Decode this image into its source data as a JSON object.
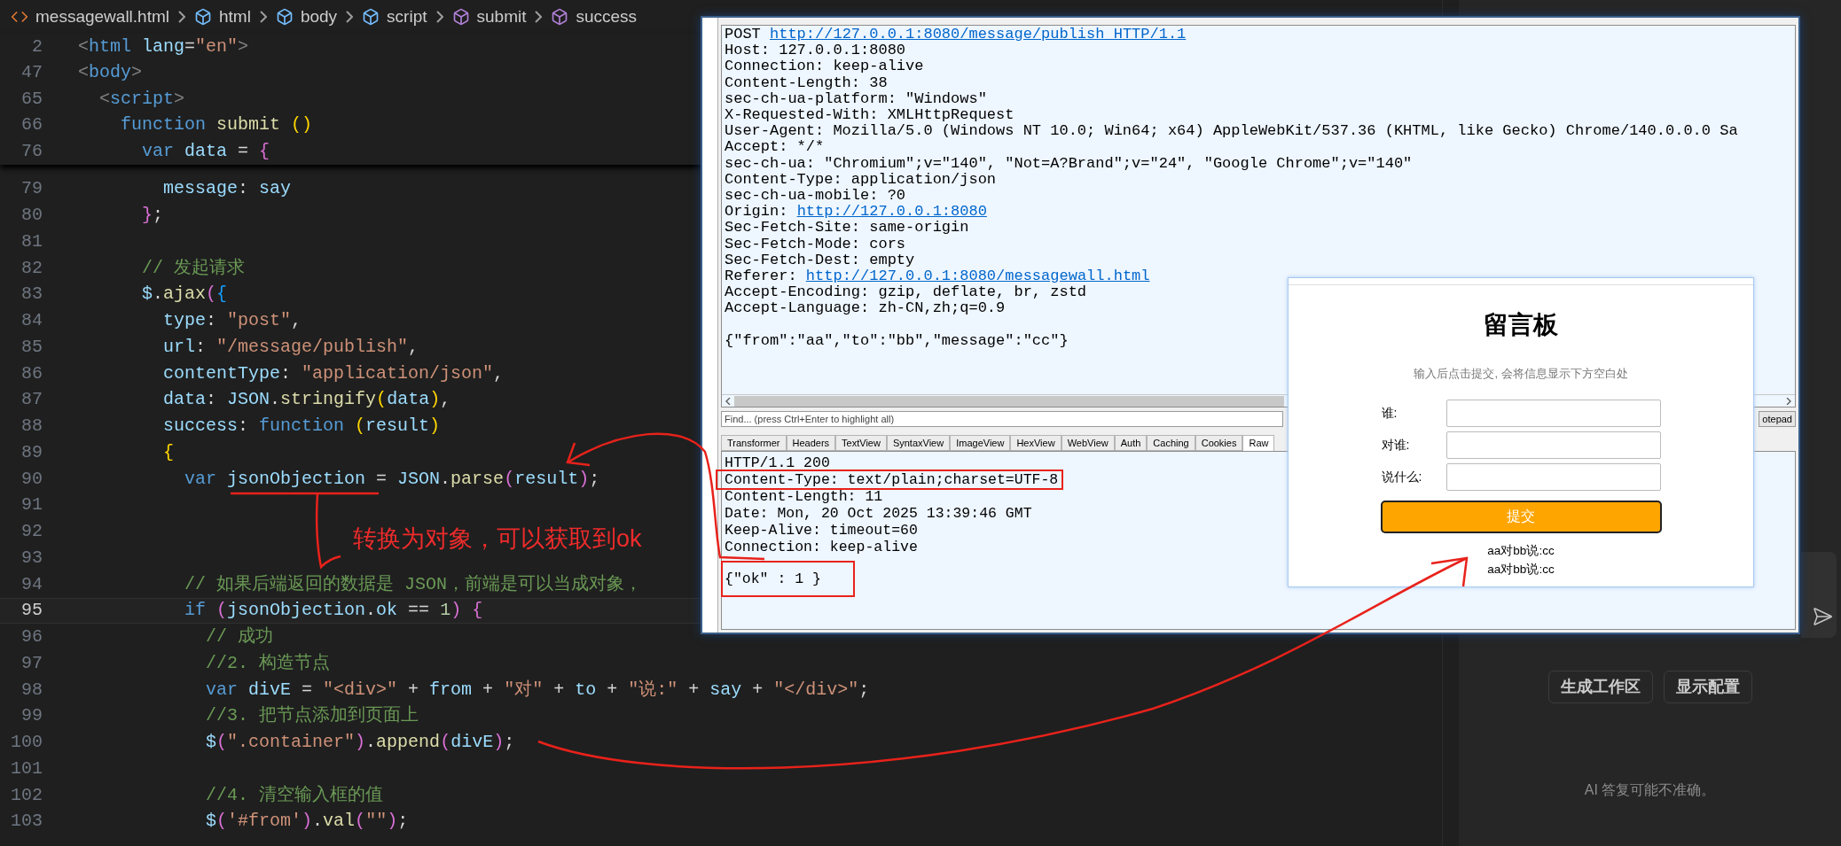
{
  "editor": {
    "breadcrumbs": [
      {
        "label": "messagewall.html",
        "kind": "file"
      },
      {
        "label": "html",
        "kind": "element"
      },
      {
        "label": "body",
        "kind": "element"
      },
      {
        "label": "script",
        "kind": "element"
      },
      {
        "label": "submit",
        "kind": "function"
      },
      {
        "label": "success",
        "kind": "function"
      }
    ],
    "sticky_lines": [
      {
        "number": "2",
        "tokens": [
          {
            "text": "<",
            "kind": "tag_punct"
          },
          {
            "text": "html",
            "kind": "tag"
          },
          {
            "text": " lang",
            "kind": "variable"
          },
          {
            "text": "=",
            "kind": "plain"
          },
          {
            "text": "\"en\"",
            "kind": "string"
          },
          {
            "text": ">",
            "kind": "tag_punct"
          }
        ]
      },
      {
        "number": "47",
        "tokens": [
          {
            "text": "<",
            "kind": "tag_punct"
          },
          {
            "text": "body",
            "kind": "tag"
          },
          {
            "text": ">",
            "kind": "tag_punct"
          }
        ]
      },
      {
        "number": "65",
        "tokens": [
          {
            "text": "  <",
            "kind": "tag_punct"
          },
          {
            "text": "script",
            "kind": "tag"
          },
          {
            "text": ">",
            "kind": "tag_punct"
          }
        ]
      },
      {
        "number": "66",
        "tokens": [
          {
            "text": "    function",
            "kind": "keyword"
          },
          {
            "text": " submit ",
            "kind": "function"
          },
          {
            "text": "()",
            "kind": "bracket_gold"
          }
        ]
      },
      {
        "number": "76",
        "tokens": [
          {
            "text": "      var",
            "kind": "keyword"
          },
          {
            "text": " data",
            "kind": "variable"
          },
          {
            "text": " = ",
            "kind": "plain"
          },
          {
            "text": "{",
            "kind": "bracket_pink"
          }
        ]
      }
    ],
    "lines": [
      {
        "number": "79",
        "current": false,
        "tokens": [
          {
            "text": "        message",
            "kind": "variable"
          },
          {
            "text": ": ",
            "kind": "plain"
          },
          {
            "text": "say",
            "kind": "variable"
          }
        ]
      },
      {
        "number": "80",
        "current": false,
        "tokens": [
          {
            "text": "      }",
            "kind": "bracket_pink"
          },
          {
            "text": ";",
            "kind": "plain"
          }
        ]
      },
      {
        "number": "81",
        "current": false
      },
      {
        "number": "82",
        "current": false,
        "tokens": [
          {
            "text": "      // 发起请求",
            "kind": "comment"
          }
        ]
      },
      {
        "number": "83",
        "current": false,
        "tokens": [
          {
            "text": "      $",
            "kind": "variable"
          },
          {
            "text": ".",
            "kind": "plain"
          },
          {
            "text": "ajax",
            "kind": "function"
          },
          {
            "text": "(",
            "kind": "bracket_pink"
          },
          {
            "text": "{",
            "kind": "bracket_blue"
          }
        ]
      },
      {
        "number": "84",
        "current": false,
        "tokens": [
          {
            "text": "        type",
            "kind": "variable"
          },
          {
            "text": ": ",
            "kind": "plain"
          },
          {
            "text": "\"post\"",
            "kind": "string"
          },
          {
            "text": ",",
            "kind": "plain"
          }
        ]
      },
      {
        "number": "85",
        "current": false,
        "tokens": [
          {
            "text": "        url",
            "kind": "variable"
          },
          {
            "text": ": ",
            "kind": "plain"
          },
          {
            "text": "\"/message/publish\"",
            "kind": "string"
          },
          {
            "text": ",",
            "kind": "plain"
          }
        ]
      },
      {
        "number": "86",
        "current": false,
        "tokens": [
          {
            "text": "        contentType",
            "kind": "variable"
          },
          {
            "text": ": ",
            "kind": "plain"
          },
          {
            "text": "\"application/json\"",
            "kind": "string"
          },
          {
            "text": ",",
            "kind": "plain"
          }
        ]
      },
      {
        "number": "87",
        "current": false,
        "tokens": [
          {
            "text": "        data",
            "kind": "variable"
          },
          {
            "text": ": ",
            "kind": "plain"
          },
          {
            "text": "JSON",
            "kind": "variable"
          },
          {
            "text": ".",
            "kind": "plain"
          },
          {
            "text": "stringify",
            "kind": "function"
          },
          {
            "text": "(",
            "kind": "bracket_gold"
          },
          {
            "text": "data",
            "kind": "variable"
          },
          {
            "text": ")",
            "kind": "bracket_gold"
          },
          {
            "text": ",",
            "kind": "plain"
          }
        ]
      },
      {
        "number": "88",
        "current": false,
        "tokens": [
          {
            "text": "        success",
            "kind": "variable"
          },
          {
            "text": ": ",
            "kind": "plain"
          },
          {
            "text": "function ",
            "kind": "keyword"
          },
          {
            "text": "(",
            "kind": "bracket_gold"
          },
          {
            "text": "result",
            "kind": "variable"
          },
          {
            "text": ")",
            "kind": "bracket_gold"
          }
        ]
      },
      {
        "number": "89",
        "current": false,
        "tokens": [
          {
            "text": "        {",
            "kind": "bracket_gold"
          }
        ]
      },
      {
        "number": "90",
        "current": false,
        "tokens": [
          {
            "text": "          var",
            "kind": "keyword"
          },
          {
            "text": " jsonObjection",
            "kind": "variable"
          },
          {
            "text": " = ",
            "kind": "plain"
          },
          {
            "text": "JSON",
            "kind": "variable"
          },
          {
            "text": ".",
            "kind": "plain"
          },
          {
            "text": "parse",
            "kind": "function"
          },
          {
            "text": "(",
            "kind": "bracket_pink"
          },
          {
            "text": "result",
            "kind": "variable"
          },
          {
            "text": ")",
            "kind": "bracket_pink"
          },
          {
            "text": ";",
            "kind": "plain"
          }
        ]
      },
      {
        "number": "91",
        "current": false
      },
      {
        "number": "92",
        "current": false
      },
      {
        "number": "93",
        "current": false
      },
      {
        "number": "94",
        "current": false,
        "tokens": [
          {
            "text": "          // 如果后端返回的数据是 JSON，前端是可以当成对象，",
            "kind": "comment"
          }
        ]
      },
      {
        "number": "95",
        "current": true,
        "tokens": [
          {
            "text": "          if ",
            "kind": "keyword"
          },
          {
            "text": "(",
            "kind": "bracket_pink"
          },
          {
            "text": "jsonObjection",
            "kind": "variable"
          },
          {
            "text": ".",
            "kind": "plain"
          },
          {
            "text": "ok",
            "kind": "variable"
          },
          {
            "text": " == ",
            "kind": "plain"
          },
          {
            "text": "1",
            "kind": "number"
          },
          {
            "text": ") ",
            "kind": "bracket_pink"
          },
          {
            "text": "{",
            "kind": "bracket_pink"
          }
        ]
      },
      {
        "number": "96",
        "current": false,
        "tokens": [
          {
            "text": "            // 成功",
            "kind": "comment"
          }
        ]
      },
      {
        "number": "97",
        "current": false,
        "tokens": [
          {
            "text": "            //2. 构造节点",
            "kind": "comment"
          }
        ]
      },
      {
        "number": "98",
        "current": false,
        "tokens": [
          {
            "text": "            var",
            "kind": "keyword"
          },
          {
            "text": " divE",
            "kind": "variable"
          },
          {
            "text": " = ",
            "kind": "plain"
          },
          {
            "text": "\"<div>\"",
            "kind": "string"
          },
          {
            "text": " + ",
            "kind": "plain"
          },
          {
            "text": "from",
            "kind": "variable"
          },
          {
            "text": " + ",
            "kind": "plain"
          },
          {
            "text": "\"对\"",
            "kind": "string"
          },
          {
            "text": " + ",
            "kind": "plain"
          },
          {
            "text": "to",
            "kind": "variable"
          },
          {
            "text": " + ",
            "kind": "plain"
          },
          {
            "text": "\"说:\"",
            "kind": "string"
          },
          {
            "text": " + ",
            "kind": "plain"
          },
          {
            "text": "say",
            "kind": "variable"
          },
          {
            "text": " + ",
            "kind": "plain"
          },
          {
            "text": "\"</div>\"",
            "kind": "string"
          },
          {
            "text": ";",
            "kind": "plain"
          }
        ]
      },
      {
        "number": "99",
        "current": false,
        "tokens": [
          {
            "text": "            //3. 把节点添加到页面上",
            "kind": "comment"
          }
        ]
      },
      {
        "number": "100",
        "current": false,
        "tokens": [
          {
            "text": "            $",
            "kind": "variable"
          },
          {
            "text": "(",
            "kind": "bracket_pink"
          },
          {
            "text": "\".container\"",
            "kind": "string"
          },
          {
            "text": ")",
            "kind": "bracket_pink"
          },
          {
            "text": ".",
            "kind": "plain"
          },
          {
            "text": "append",
            "kind": "function"
          },
          {
            "text": "(",
            "kind": "bracket_pink"
          },
          {
            "text": "divE",
            "kind": "variable"
          },
          {
            "text": ")",
            "kind": "bracket_pink"
          },
          {
            "text": ";",
            "kind": "plain"
          }
        ]
      },
      {
        "number": "101",
        "current": false
      },
      {
        "number": "102",
        "current": false,
        "tokens": [
          {
            "text": "            //4. 清空输入框的值",
            "kind": "comment"
          }
        ]
      },
      {
        "number": "103",
        "current": false,
        "tokens": [
          {
            "text": "            $",
            "kind": "variable"
          },
          {
            "text": "(",
            "kind": "bracket_pink"
          },
          {
            "text": "'#from'",
            "kind": "string"
          },
          {
            "text": ")",
            "kind": "bracket_pink"
          },
          {
            "text": ".",
            "kind": "plain"
          },
          {
            "text": "val",
            "kind": "function"
          },
          {
            "text": "(",
            "kind": "bracket_pink"
          },
          {
            "text": "\"\"",
            "kind": "string"
          },
          {
            "text": ")",
            "kind": "bracket_pink"
          },
          {
            "text": ";",
            "kind": "plain"
          }
        ]
      }
    ]
  },
  "annotation": {
    "note": "转换为对象，可以获取到ok"
  },
  "fiddler": {
    "request_lines": [
      {
        "kind": "header",
        "text": "POST ",
        "link": "http://127.0.0.1:8080/message/publish HTTP/1.1"
      },
      {
        "kind": "header",
        "text": "Host: 127.0.0.1:8080"
      },
      {
        "kind": "header",
        "text": "Connection: keep-alive"
      },
      {
        "kind": "header",
        "text": "Content-Length: 38"
      },
      {
        "kind": "header",
        "text": "sec-ch-ua-platform: \"Windows\""
      },
      {
        "kind": "header",
        "text": "X-Requested-With: XMLHttpRequest"
      },
      {
        "kind": "header",
        "text": "User-Agent: Mozilla/5.0 (Windows NT 10.0; Win64; x64) AppleWebKit/537.36 (KHTML, like Gecko) Chrome/140.0.0.0 Sa"
      },
      {
        "kind": "header",
        "text": "Accept: */*"
      },
      {
        "kind": "header",
        "text": "sec-ch-ua: \"Chromium\";v=\"140\", \"Not=A?Brand\";v=\"24\", \"Google Chrome\";v=\"140\""
      },
      {
        "kind": "header",
        "text": "Content-Type: application/json"
      },
      {
        "kind": "header",
        "text": "sec-ch-ua-mobile: ?0"
      },
      {
        "kind": "header",
        "text": "Origin: ",
        "link": "http://127.0.0.1:8080"
      },
      {
        "kind": "header",
        "text": "Sec-Fetch-Site: same-origin"
      },
      {
        "kind": "header",
        "text": "Sec-Fetch-Mode: cors"
      },
      {
        "kind": "header",
        "text": "Sec-Fetch-Dest: empty"
      },
      {
        "kind": "header",
        "text": "Referer: ",
        "link": "http://127.0.0.1:8080/messagewall.html"
      },
      {
        "kind": "header",
        "text": "Accept-Encoding: gzip, deflate, br, zstd"
      },
      {
        "kind": "header",
        "text": "Accept-Language: zh-CN,zh;q=0.9"
      },
      {
        "kind": "body",
        "text": "{\"from\":\"aa\",\"to\":\"bb\",\"message\":\"cc\"}"
      }
    ],
    "find_placeholder": "Find... (press Ctrl+Enter to highlight all)",
    "notepad_button": "otepad",
    "tabs": [
      {
        "label": "Transformer",
        "selected": false
      },
      {
        "label": "Headers",
        "selected": false
      },
      {
        "label": "TextView",
        "selected": false
      },
      {
        "label": "SyntaxView",
        "selected": false
      },
      {
        "label": "ImageView",
        "selected": false
      },
      {
        "label": "HexView",
        "selected": false
      },
      {
        "label": "WebView",
        "selected": false
      },
      {
        "label": "Auth",
        "selected": false
      },
      {
        "label": "Caching",
        "selected": false
      },
      {
        "label": "Cookies",
        "selected": false
      },
      {
        "label": "Raw",
        "selected": true
      }
    ],
    "response_lines": [
      {
        "kind": "header",
        "text": "HTTP/1.1 200",
        "highlighted": false
      },
      {
        "kind": "header",
        "text": "Content-Type: text/plain;charset=UTF-8",
        "highlighted": true
      },
      {
        "kind": "header",
        "text": "Content-Length: 11",
        "highlighted": false
      },
      {
        "kind": "header",
        "text": "Date: Mon, 20 Oct 2025 13:39:46 GMT",
        "highlighted": false
      },
      {
        "kind": "header",
        "text": "Keep-Alive: timeout=60",
        "highlighted": false
      },
      {
        "kind": "header",
        "text": "Connection: keep-alive",
        "highlighted": false
      },
      {
        "kind": "body",
        "text": "{\"ok\" : 1 }",
        "highlighted": true
      }
    ]
  },
  "message_board": {
    "title": "留言板",
    "hint": "输入后点击提交, 会将信息显示下方空白处",
    "fields": [
      {
        "label": "谁:"
      },
      {
        "label": "对谁:"
      },
      {
        "label": "说什么:"
      }
    ],
    "submit": "提交",
    "messages": [
      "aa对bb说:cc",
      "aa对bb说:cc"
    ]
  },
  "assistant": {
    "buttons": [
      "生成工作区",
      "显示配置"
    ],
    "disclaimer": "AI 答复可能不准确。"
  }
}
